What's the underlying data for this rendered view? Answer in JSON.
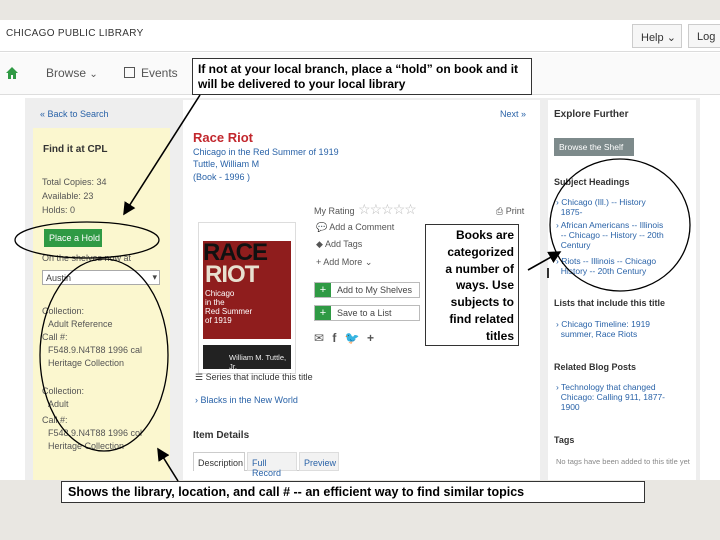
{
  "header": {
    "logo": "CHICAGO PUBLIC LIBRARY",
    "help": "Help",
    "login": "Log"
  },
  "nav": {
    "browse": "Browse",
    "events": "Events"
  },
  "back_link": "« Back to Search",
  "next_link": "Next »",
  "find": {
    "title": "Find it at CPL",
    "total": "Total Copies: 34",
    "available": "Available: 23",
    "holds": "Holds: 0",
    "place_hold": "Place a Hold",
    "shelves_label": "On the shelves now at",
    "branch": "Austin",
    "collection_label_1": "Collection:",
    "collection_1": "Adult Reference",
    "call_label_1": "Call #:",
    "call_1a": "F548.9.N4T88 1996 cal",
    "call_1b": "Heritage Collection",
    "collection_label_2": "Collection:",
    "collection_2": "Adult",
    "call_label_2": "Call #:",
    "call_2a": "F548.9.N4T88 1996 col",
    "call_2b": "Heritage Collection"
  },
  "book": {
    "title": "Race Riot",
    "subtitle": "Chicago in the Red Summer of 1919",
    "author": "Tuttle, William M",
    "format": "(Book - 1996 )",
    "my_rating": "My Rating",
    "print": "Print",
    "add_comment": "Add a Comment",
    "add_tags": "Add Tags",
    "add_more": "Add More",
    "add_shelves": "Add to My Shelves",
    "save_list": "Save to a List",
    "series_heading": "Series that include this title",
    "series_item": "Blacks in the New World",
    "details_heading": "Item Details",
    "tabs": [
      "Description",
      "Full Record",
      "Preview"
    ]
  },
  "cover": {
    "title_line1": "RACE",
    "title_line2": "RIOT",
    "sub1": "Chicago",
    "sub2": "in the",
    "sub3": "Red Summer",
    "sub4": "of 1919",
    "author": "William M. Tuttle, Jr."
  },
  "explore": {
    "heading": "Explore Further",
    "shelf_btn": "Browse the Shelf",
    "subject_heading": "Subject Headings",
    "subjects": [
      [
        "Chicago (Ill.) -- History",
        "1875-"
      ],
      [
        "African Americans -- Illinois",
        "-- Chicago -- History -- 20th",
        "Century"
      ],
      [
        "Riots -- Illinois -- Chicago",
        "History -- 20th Century"
      ]
    ],
    "lists_heading": "Lists that include this title",
    "list_item": [
      "Chicago Timeline: 1919",
      "summer, Race Riots"
    ],
    "blog_heading": "Related Blog Posts",
    "blog_item": [
      "Technology that changed",
      "Chicago: Calling 911, 1877-",
      "1900"
    ],
    "tags_heading": "Tags",
    "tags_text": "No tags have been added to this title yet"
  },
  "callouts": {
    "hold": "If not at your local branch, place a “hold” on book and it will be delivered to your local library",
    "subjects": [
      "Books are",
      "categorized",
      "a number of",
      "ways.  Use",
      "subjects to",
      "find related",
      "titles"
    ],
    "bottom": "Shows the library, location, and call # -- an efficient way to find similar topics"
  },
  "colors": {
    "green": "#2f9a44",
    "link": "#2a63a8",
    "title_red": "#c2272d",
    "panel_yellow": "#fbf7cf"
  }
}
